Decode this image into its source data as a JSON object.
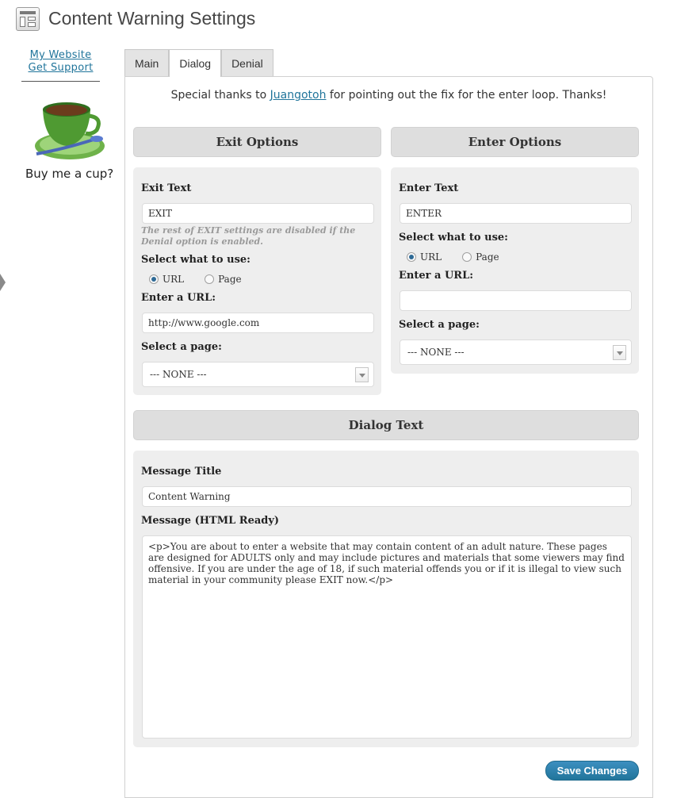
{
  "header": {
    "title": "Content Warning Settings",
    "icon": "settings-page-icon"
  },
  "sidebar": {
    "links": [
      "My Website",
      "Get Support"
    ],
    "buy_text": "Buy me a cup?"
  },
  "tabs": [
    {
      "label": "Main",
      "active": false
    },
    {
      "label": "Dialog",
      "active": true
    },
    {
      "label": "Denial",
      "active": false
    }
  ],
  "notice": {
    "before": "Special thanks to ",
    "link": "Juangotoh",
    "after": " for pointing out the fix for the enter loop. Thanks!"
  },
  "exit": {
    "heading": "Exit Options",
    "text_label": "Exit Text",
    "text_value": "EXIT",
    "note": "The rest of EXIT settings are disabled if the Denial option is enabled.",
    "select_label": "Select what to use:",
    "radio_url": "URL",
    "radio_page": "Page",
    "url_label": "Enter a URL:",
    "url_value": "http://www.google.com",
    "page_label": "Select a page:",
    "page_value": "--- NONE ---"
  },
  "enter": {
    "heading": "Enter Options",
    "text_label": "Enter Text",
    "text_value": "ENTER",
    "select_label": "Select what to use:",
    "radio_url": "URL",
    "radio_page": "Page",
    "url_label": "Enter a URL:",
    "url_value": "",
    "page_label": "Select a page:",
    "page_value": "--- NONE ---"
  },
  "dialog": {
    "heading": "Dialog Text",
    "title_label": "Message Title",
    "title_value": "Content Warning",
    "message_label": "Message (HTML Ready)",
    "message_value": "<p>You are about to enter a website that may contain content of an adult nature. These pages are designed for ADULTS only and may include pictures and materials that some viewers may find offensive. If you are under the age of 18, if such material offends you or if it is illegal to view such material in your community please EXIT now.</p>"
  },
  "save_label": "Save Changes",
  "colors": {
    "accent": "#21759b",
    "section_bg": "#dedede",
    "box_bg": "#eeeeee"
  }
}
